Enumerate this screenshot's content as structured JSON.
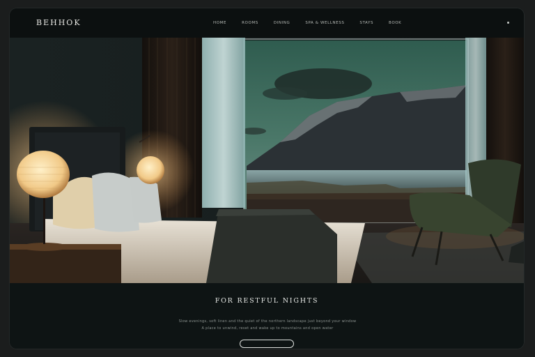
{
  "brand": {
    "logo_text": "BEHHOK"
  },
  "nav": {
    "items": [
      "HOME",
      "ROOMS",
      "DINING",
      "SPA & WELLNESS",
      "STAYS",
      "BOOK"
    ]
  },
  "hero": {
    "alt": "Dark hotel bedroom with a large window overlooking a mountain lake"
  },
  "content": {
    "headline": "FOR RESTFUL NIGHTS",
    "description_lines": [
      "Slow evenings, soft linen and the quiet of the northern landscape just beyond your window",
      "A place to unwind, reset and wake up to mountains and open water"
    ],
    "cta_label": ""
  },
  "colors": {
    "background": "#0f1414",
    "sky": "#2d5a4d",
    "mountain": "#2a3034",
    "lamp": "#f1c987",
    "text": "#e7e9e6"
  }
}
